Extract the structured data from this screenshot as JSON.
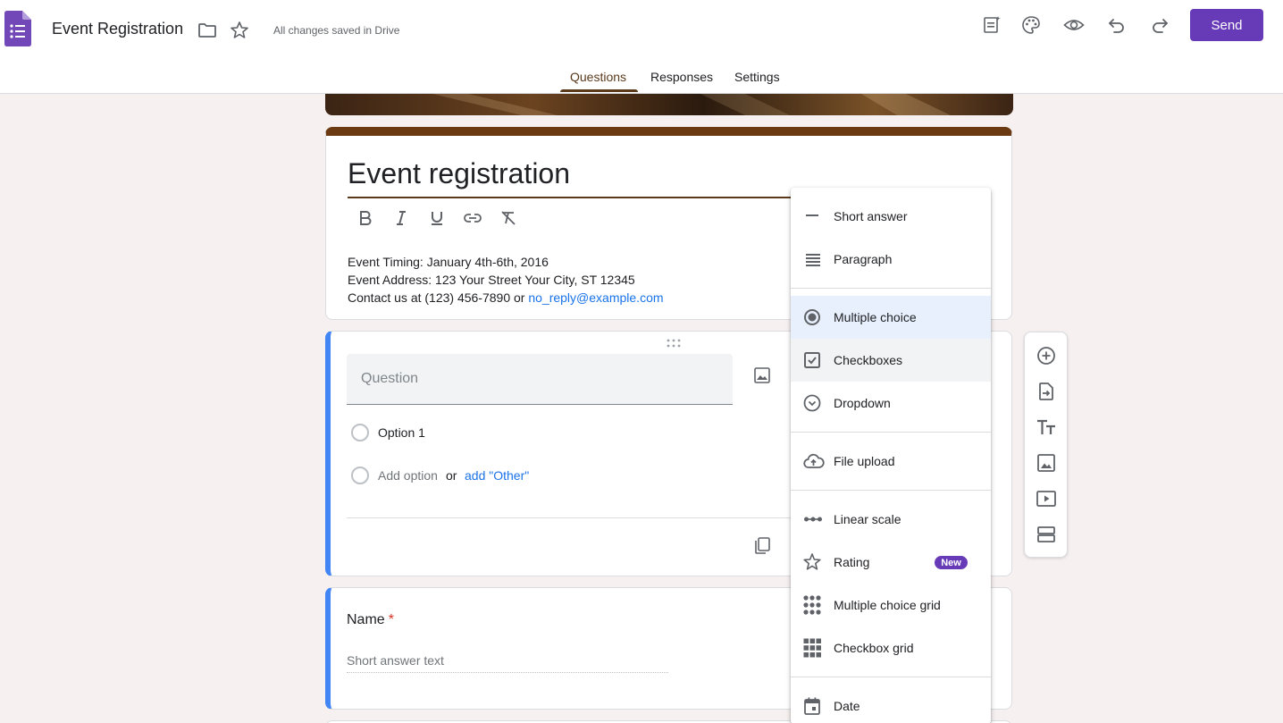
{
  "header": {
    "doc_title": "Event Registration",
    "save_status": "All changes saved in Drive",
    "send_label": "Send",
    "tabs": [
      {
        "label": "Questions",
        "active": true
      },
      {
        "label": "Responses",
        "active": false
      },
      {
        "label": "Settings",
        "active": false
      }
    ],
    "icons": [
      "forms-logo-icon",
      "folder-icon",
      "star-icon",
      "addon-icon",
      "palette-icon",
      "preview-eye-icon",
      "undo-icon",
      "redo-icon"
    ]
  },
  "form": {
    "title": "Event registration",
    "description_lines": [
      "Event Timing: January 4th-6th, 2016",
      "Event Address: 123 Your Street Your City, ST 12345",
      "Contact us at (123) 456-7890 or "
    ],
    "contact_email": "no_reply@example.com",
    "format_icons": [
      "bold-icon",
      "italic-icon",
      "underline-icon",
      "link-icon",
      "clear-format-icon"
    ]
  },
  "question": {
    "placeholder": "Question",
    "option1": "Option 1",
    "add_option": "Add option",
    "or_text": "or",
    "add_other": "add \"Other\""
  },
  "name_question": {
    "label": "Name",
    "required_mark": "*",
    "placeholder": "Short answer text"
  },
  "type_menu": {
    "items": [
      {
        "label": "Short answer",
        "icon": "short-answer-icon"
      },
      {
        "label": "Paragraph",
        "icon": "paragraph-icon"
      },
      {
        "label": "Multiple choice",
        "icon": "radio-icon",
        "selected": true
      },
      {
        "label": "Checkboxes",
        "icon": "checkbox-icon",
        "hover": true
      },
      {
        "label": "Dropdown",
        "icon": "dropdown-icon"
      },
      {
        "label": "File upload",
        "icon": "cloud-upload-icon"
      },
      {
        "label": "Linear scale",
        "icon": "linear-scale-icon"
      },
      {
        "label": "Rating",
        "icon": "star-outline-icon",
        "badge": "New"
      },
      {
        "label": "Multiple choice grid",
        "icon": "mc-grid-icon"
      },
      {
        "label": "Checkbox grid",
        "icon": "checkbox-grid-icon"
      },
      {
        "label": "Date",
        "icon": "calendar-icon"
      }
    ]
  },
  "side_toolbar": {
    "icons": [
      "add-question-icon",
      "import-questions-icon",
      "add-title-icon",
      "add-image-icon",
      "add-video-icon",
      "add-section-icon"
    ]
  },
  "colors": {
    "accent": "#673ab7",
    "theme": "#5b3a1c",
    "question_border": "#4285f4",
    "background": "#f6f1f0"
  }
}
